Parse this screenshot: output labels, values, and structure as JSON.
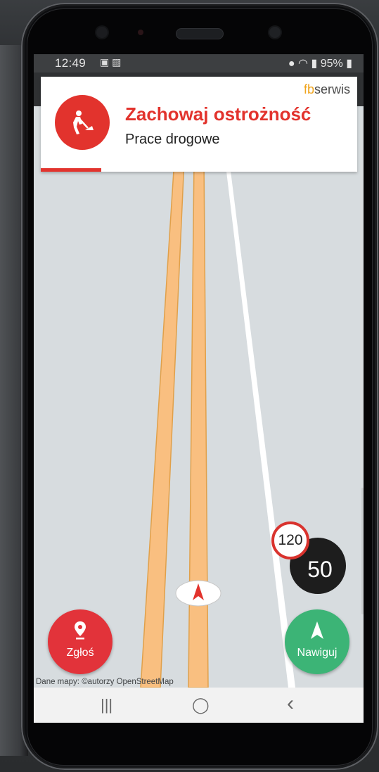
{
  "status_bar": {
    "time": "12:49",
    "left_icons": "▣ ▨",
    "right_text": "95%"
  },
  "alert": {
    "title": "Zachowaj ostrożność",
    "subtitle": "Prace drogowe",
    "brand_fb": "fb",
    "brand_rest": "serwis",
    "icon": "road-works-icon",
    "color": "#e2332d"
  },
  "speed": {
    "limit": "120",
    "current": "50"
  },
  "buttons": {
    "report_label": "Zgłoś",
    "navigate_label": "Nawiguj"
  },
  "map": {
    "credit": "Dane mapy: ©autorzy OpenStreetMap",
    "road_color": "#f9bf80",
    "background": "#d7dcdf"
  },
  "nav_bar": {
    "recent": "|||",
    "home": "◯",
    "back": "‹"
  }
}
